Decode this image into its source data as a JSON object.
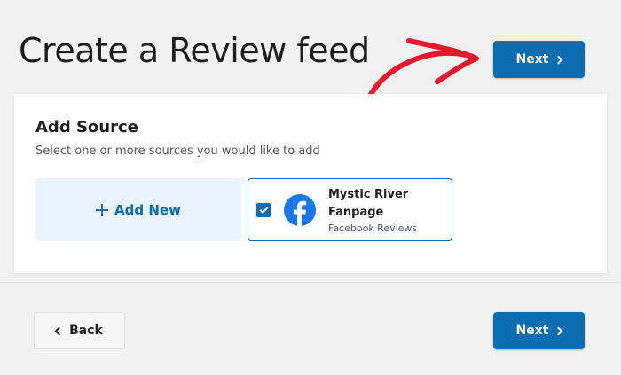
{
  "header": {
    "title": "Create a Review feed",
    "next_label": "Next"
  },
  "source_panel": {
    "title": "Add Source",
    "subtitle": "Select one or more sources you would like to add",
    "add_new_label": "Add New",
    "sources": [
      {
        "name": "Mystic River Fanpage",
        "type": "Facebook Reviews",
        "icon": "facebook-icon",
        "selected": true
      }
    ]
  },
  "footer": {
    "back_label": "Back",
    "next_label": "Next"
  },
  "colors": {
    "accent": "#0b6db2",
    "background": "#f1f1f1",
    "facebook": "#1877f2",
    "annotation": "#e8192c"
  }
}
